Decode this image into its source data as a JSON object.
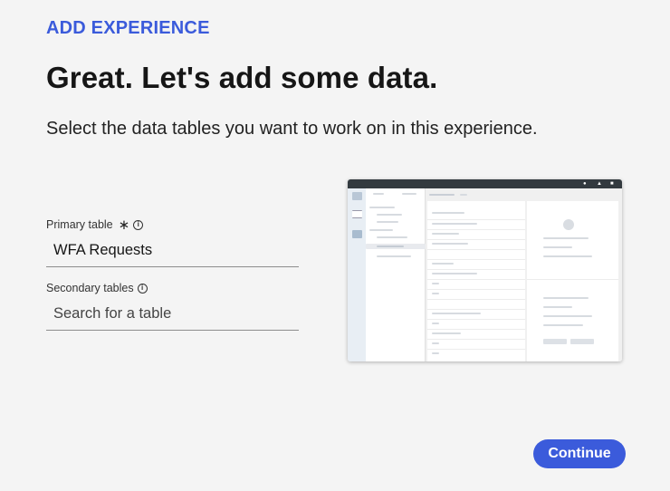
{
  "header": {
    "eyebrow": "ADD EXPERIENCE",
    "title": "Great. Let's add some data.",
    "subtitle": "Select the data tables you want to work on in this experience."
  },
  "form": {
    "primary": {
      "label": "Primary table",
      "value": "WFA Requests",
      "required_icon": "asterisk-icon",
      "info_icon": "info-icon"
    },
    "secondary": {
      "label": "Secondary tables",
      "placeholder": "Search for a table",
      "value": "",
      "info_icon": "info-icon"
    }
  },
  "preview": {
    "description_icon": "workspace-preview-image"
  },
  "footer": {
    "continue_label": "Continue"
  },
  "colors": {
    "accent": "#3b5bdb",
    "background": "#f4f4f4",
    "preview_topbar": "#333a3f"
  }
}
